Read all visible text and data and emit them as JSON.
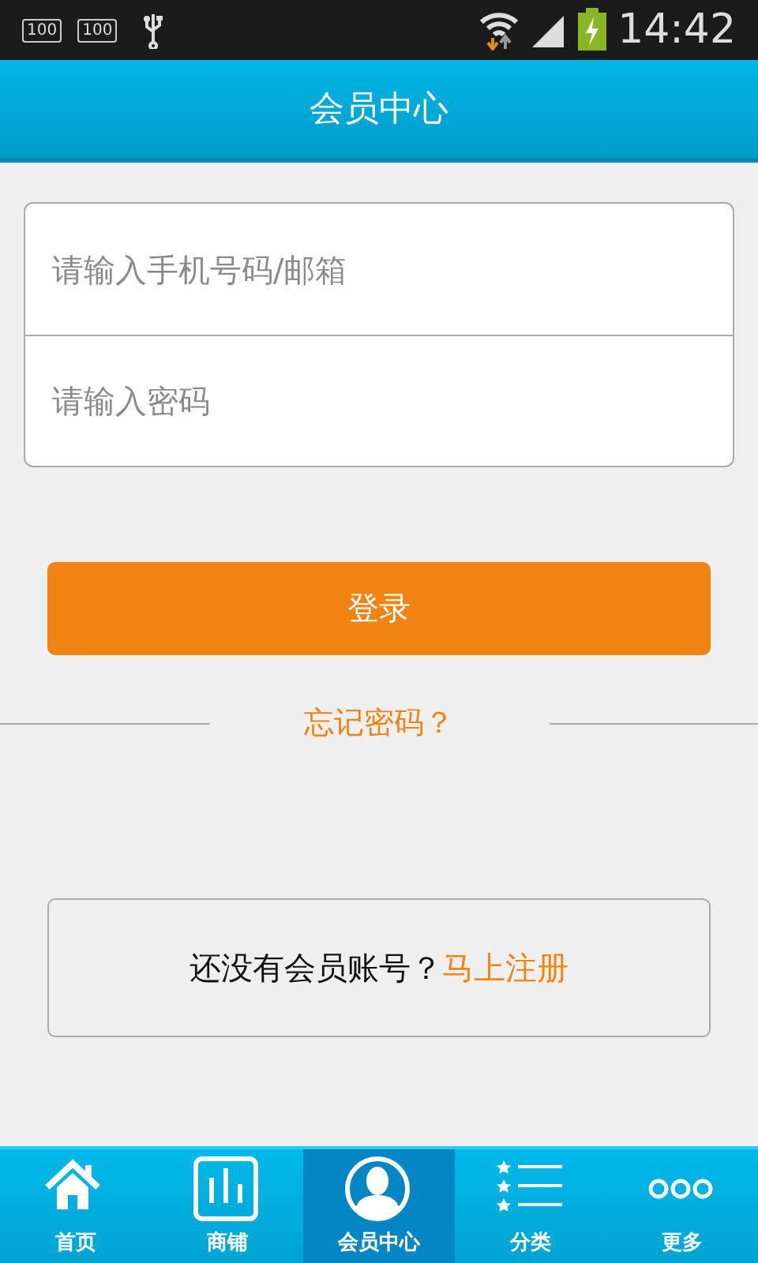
{
  "status_bar": {
    "badges": [
      "100",
      "100"
    ],
    "time": "14:42"
  },
  "header": {
    "title": "会员中心"
  },
  "form": {
    "fields": [
      {
        "placeholder": "请输入手机号码/邮箱"
      },
      {
        "placeholder": "请输入密码"
      }
    ]
  },
  "login_button": "登录",
  "forgot_link": "忘记密码？",
  "register": {
    "text": "还没有会员账号？",
    "link": "马上注册"
  },
  "tabs": [
    {
      "label": "首页",
      "selected": false
    },
    {
      "label": "商铺",
      "selected": false
    },
    {
      "label": "会员中心",
      "selected": true
    },
    {
      "label": "分类",
      "selected": false
    },
    {
      "label": "更多",
      "selected": false
    }
  ]
}
